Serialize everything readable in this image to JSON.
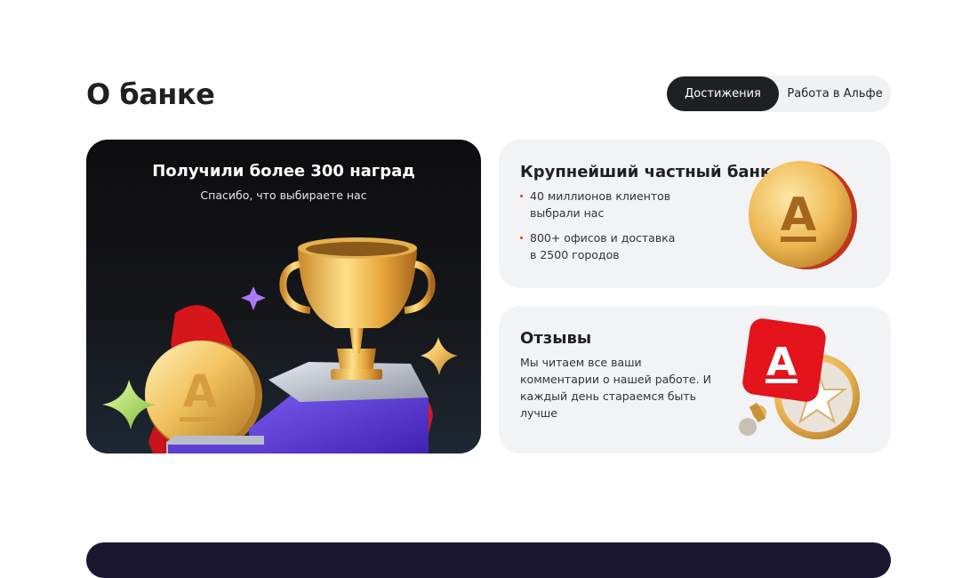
{
  "section": {
    "title": "О банке"
  },
  "tabs": [
    {
      "label": "Достижения",
      "active": true
    },
    {
      "label": "Работа в Альфе",
      "active": false
    }
  ],
  "awards_card": {
    "title": "Получили более 300 наград",
    "subtitle": "Спасибо, что выбираете нас"
  },
  "bank_card": {
    "title": "Крупнейший частный банк",
    "bullets": [
      "40 миллионов клиентов выбрали нас",
      "800+ офисов и доставка в 2500 городов"
    ]
  },
  "reviews_card": {
    "title": "Отзывы",
    "text": "Мы читаем все ваши комментарии о нашей работе. И каждый день стараемся быть лучше"
  },
  "colors": {
    "brand_red": "#ef3124",
    "dark_text": "#1f2022",
    "card_bg": "#f2f3f5"
  }
}
